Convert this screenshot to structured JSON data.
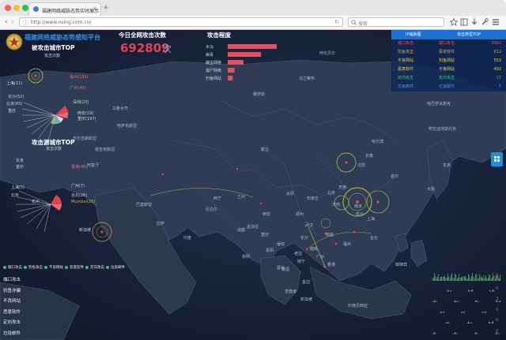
{
  "browser": {
    "tab_title": "福建网络威胁态势实时展示",
    "url": "http://www.nsing.com.cn/",
    "search_placeholder": "搜索",
    "newtab_label": "+",
    "back": "‹",
    "forward": "›",
    "reload": "↻",
    "info": "ⓘ",
    "icons": [
      "star-icon",
      "bookmarks-icon",
      "download-icon",
      "tools-icon",
      "menu-icon"
    ]
  },
  "header": {
    "logo_text": "福建网络威胁态势感知平台",
    "target_title": "被攻击城市TOP",
    "target_sub": "攻击次数",
    "source_title": "攻击源城市TOP",
    "source_sub": "攻击次数",
    "count_title": "今日全网攻击次数",
    "count_value": "692809",
    "count_unit": "次",
    "degree_title": "攻击程度"
  },
  "degree": [
    {
      "label": "木马",
      "value": 100
    },
    {
      "label": "病毒",
      "value": 68
    },
    {
      "label": "蠕虫网络",
      "value": 32
    },
    {
      "label": "僵尸网络",
      "value": 14
    },
    {
      "label": "钓鱼网站",
      "value": 10
    }
  ],
  "target_cities": [
    {
      "name": "北京",
      "value": "(843)"
    },
    {
      "name": "福州(132)",
      "value": ""
    },
    {
      "name": "上海(11)",
      "value": ""
    },
    {
      "name": "长沙(52)",
      "value": ""
    },
    {
      "name": "北京(65)",
      "value": ""
    },
    {
      "name": "广州(40)",
      "value": ""
    },
    {
      "name": "重庆",
      "value": "(32)"
    },
    {
      "name": "深圳(23)",
      "value": ""
    },
    {
      "name": "西安(19)",
      "value": ""
    },
    {
      "name": "重庆(197)",
      "value": ""
    }
  ],
  "source_cities": [
    {
      "name": "东京",
      "value": ""
    },
    {
      "name": "首尔",
      "value": ""
    },
    {
      "name": "香港(48)",
      "value": ""
    },
    {
      "name": "上海(5)",
      "value": ""
    },
    {
      "name": "北京",
      "value": ""
    },
    {
      "name": "广州(7)",
      "value": ""
    },
    {
      "name": "杭州",
      "value": ""
    },
    {
      "name": "台北(26)",
      "value": ""
    },
    {
      "name": "首尔",
      "value": ""
    },
    {
      "name": "Mumbai(26)",
      "value": ""
    },
    {
      "name": "新加坡",
      "value": ""
    },
    {
      "name": "曼谷",
      "value": ""
    }
  ],
  "legend": {
    "tab_left": "IP威胁图",
    "tab_right": "攻击类型TOP",
    "rows": [
      {
        "a": "端口攻击",
        "b": "端口攻击",
        "n": "3962",
        "color": "#e05050"
      },
      {
        "a": "钓鱼攻击",
        "b": "恶意软件",
        "n": "612",
        "color": "#e8a030"
      },
      {
        "a": "不良网站",
        "b": "钓鱼网站",
        "n": "553",
        "color": "#e8d23a"
      },
      {
        "a": "恶意软件",
        "b": "不良网站",
        "n": "492",
        "color": "#e8d23a"
      },
      {
        "a": "定向攻击",
        "b": "定向攻击",
        "n": "17",
        "color": "#3ac46d"
      },
      {
        "a": "垃圾邮件",
        "b": "垃圾邮件",
        "n": "5",
        "color": "#3a9ce8"
      }
    ]
  },
  "checkboxes": [
    "端口攻击",
    "钓鱼攻击",
    "不良网站",
    "恶意软件",
    "定向攻击",
    "垃圾邮件"
  ],
  "attack_types": [
    {
      "label": "端口攻击",
      "value": "3"
    },
    {
      "label": "钓鱼诈骗",
      "value": "0"
    },
    {
      "label": "不良网站",
      "value": "3"
    },
    {
      "label": "恶意软件",
      "value": "0"
    },
    {
      "label": "定向攻击",
      "value": "0"
    },
    {
      "label": "垃圾邮件",
      "value": "0"
    }
  ],
  "map_labels": [
    "呼伦贝尔",
    "乌兰察布",
    "乌鲁木齐",
    "哈萨克斯坦",
    "吉尔吉斯斯坦",
    "巴基斯坦",
    "印度",
    "尼泊尔",
    "孟加拉",
    "缅甸",
    "泰国",
    "老挝",
    "越南",
    "菲律宾",
    "北京",
    "天津",
    "石家庄",
    "太原",
    "郑州",
    "西安",
    "兰州",
    "西宁",
    "拉萨",
    "成都",
    "重庆",
    "贵阳",
    "昆明",
    "长沙",
    "武汉",
    "南昌",
    "福州",
    "台北",
    "广州",
    "香港",
    "南宁",
    "杭州",
    "上海",
    "南京",
    "济南",
    "沈阳",
    "长春",
    "哈尔滨",
    "首尔",
    "东京",
    "大阪",
    "蒙古",
    "俄罗斯",
    "哈巴罗夫斯克",
    "符拉迪沃斯托克",
    "阿富汗",
    "塔吉克斯坦",
    "吉隆坡",
    "新加坡",
    "曼谷",
    "金边",
    "印度尼西亚"
  ]
}
